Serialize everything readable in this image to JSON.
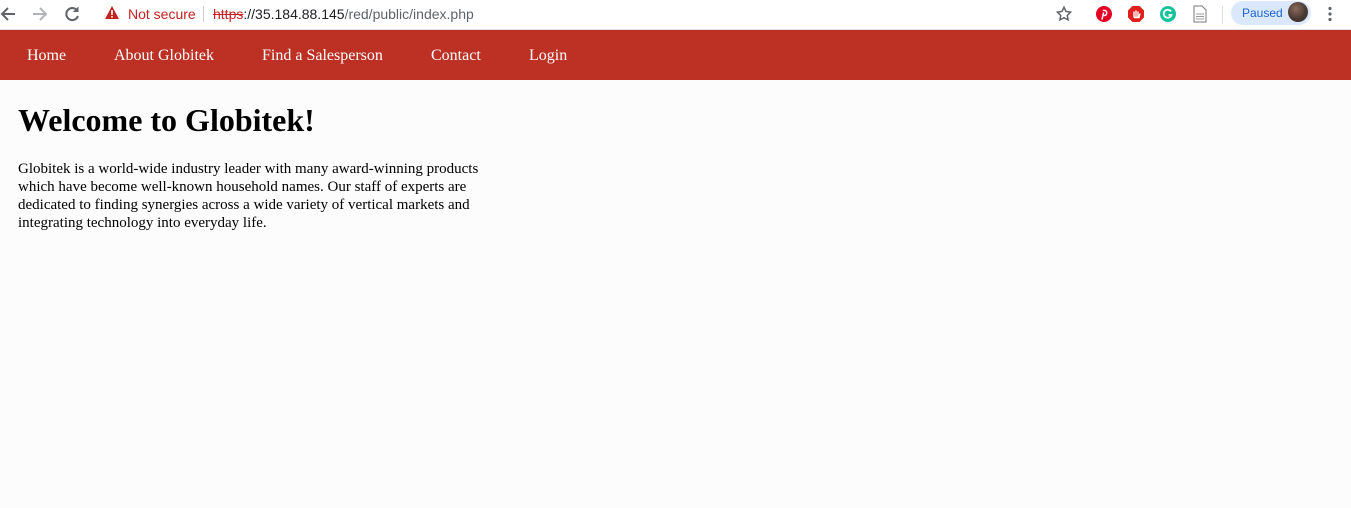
{
  "browser": {
    "security_label": "Not secure",
    "url_scheme": "https",
    "url_host": "://35.184.88.145",
    "url_path": "/red/public/index.php",
    "profile_status": "Paused",
    "icons": [
      "back-arrow-icon",
      "forward-arrow-icon",
      "reload-icon",
      "warning-icon",
      "star-icon",
      "pinterest-icon",
      "adblock-icon",
      "grammarly-icon",
      "page-icon",
      "profile-avatar",
      "more-vert-icon"
    ]
  },
  "nav": {
    "items": [
      {
        "label": "Home"
      },
      {
        "label": "About Globitek"
      },
      {
        "label": "Find a Salesperson"
      },
      {
        "label": "Contact"
      },
      {
        "label": "Login"
      }
    ],
    "background": "#bc3123",
    "text_color": "#ffffff"
  },
  "main": {
    "title": "Welcome to Globitek!",
    "intro": "Globitek is a world-wide industry leader with many award-winning products which have become well-known household names. Our staff of experts are dedicated to finding synergies across a wide variety of vertical markets and integrating technology into everyday life."
  }
}
